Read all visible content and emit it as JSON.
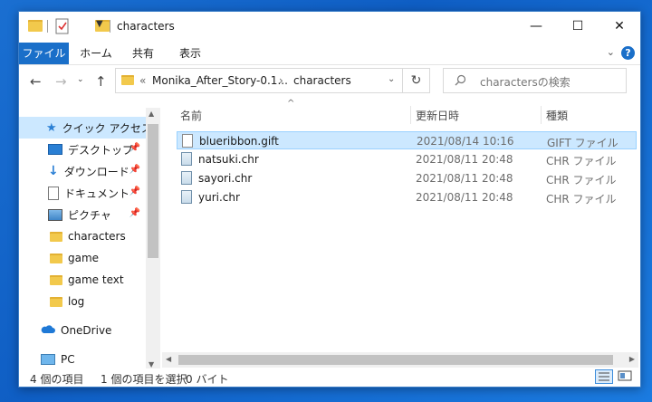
{
  "window": {
    "title": "characters",
    "controls": {
      "minimize": "—",
      "maximize": "☐",
      "close": "✕"
    }
  },
  "ribbon": {
    "tabs": [
      "ファイル",
      "ホーム",
      "共有",
      "表示"
    ],
    "help": "?"
  },
  "address": {
    "overflow": "«",
    "path": [
      "Monika_After_Story-0.1...",
      "characters"
    ],
    "separator": "›"
  },
  "search": {
    "placeholder": "charactersの検索"
  },
  "nav": {
    "quick_access": "クイック アクセス",
    "items": [
      {
        "label": "デスクトップ",
        "pinned": true,
        "icon": "desktop-icon"
      },
      {
        "label": "ダウンロード",
        "pinned": true,
        "icon": "download-icon"
      },
      {
        "label": "ドキュメント",
        "pinned": true,
        "icon": "document-icon"
      },
      {
        "label": "ピクチャ",
        "pinned": true,
        "icon": "pictures-icon"
      },
      {
        "label": "characters",
        "pinned": false,
        "icon": "folder-icon"
      },
      {
        "label": "game",
        "pinned": false,
        "icon": "folder-icon"
      },
      {
        "label": "game text",
        "pinned": false,
        "icon": "folder-icon"
      },
      {
        "label": "log",
        "pinned": false,
        "icon": "folder-icon"
      }
    ],
    "onedrive": "OneDrive",
    "pc": "PC"
  },
  "list": {
    "columns": [
      "名前",
      "更新日時",
      "種類"
    ],
    "files": [
      {
        "name": "blueribbon.gift",
        "modified": "2021/08/14 10:16",
        "type": "GIFT ファイル",
        "selected": true
      },
      {
        "name": "natsuki.chr",
        "modified": "2021/08/11 20:48",
        "type": "CHR ファイル",
        "selected": false
      },
      {
        "name": "sayori.chr",
        "modified": "2021/08/11 20:48",
        "type": "CHR ファイル",
        "selected": false
      },
      {
        "name": "yuri.chr",
        "modified": "2021/08/11 20:48",
        "type": "CHR ファイル",
        "selected": false
      }
    ]
  },
  "status": {
    "count": "4 個の項目",
    "selection": "1 個の項目を選択",
    "size": "0 バイト"
  },
  "colors": {
    "accent": "#1a6fc9",
    "selection": "#cce8ff",
    "folder": "#f2c94c"
  }
}
